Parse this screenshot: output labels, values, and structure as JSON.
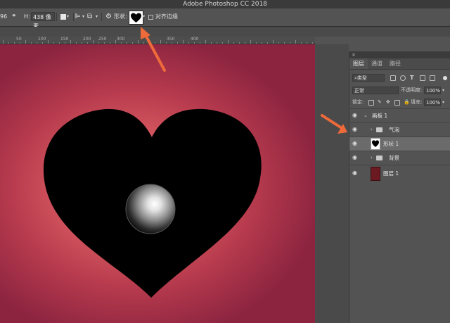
{
  "app": {
    "title": "Adobe Photoshop CC 2018"
  },
  "options_bar": {
    "w_value_partial": "96",
    "h_label": "H:",
    "h_value": "438 像素",
    "shape_label": "形状:",
    "align_edges_label": "对齐边缘"
  },
  "ruler": {
    "labels": [
      "50",
      "100",
      "150",
      "200",
      "250",
      "300",
      "350",
      "400"
    ]
  },
  "panel": {
    "close": "×",
    "tabs": [
      "图层",
      "通道",
      "路径"
    ],
    "filter_kind": "类型",
    "blend_mode": "正常",
    "opacity_label": "不透明度:",
    "opacity_value": "100%",
    "lock_label": "锁定:",
    "fill_label": "填充:",
    "fill_value": "100%",
    "layers": [
      {
        "name": "画板 1"
      },
      {
        "name": "气泡"
      },
      {
        "name": "形状 1"
      },
      {
        "name": "背景"
      },
      {
        "name": "图层 1"
      }
    ]
  },
  "colors": {
    "canvas_center": "#e46a6c",
    "canvas_edge": "#8c2440",
    "heart": "#000000",
    "annotation_arrow": "#ee6a3a",
    "layer_thumb_red": "#6b1a22"
  },
  "icons": {
    "link": "link-icon",
    "shape_preset": "heart-shape-icon",
    "eye": "eye-icon",
    "folder": "folder-icon",
    "gear": "gear-icon"
  }
}
